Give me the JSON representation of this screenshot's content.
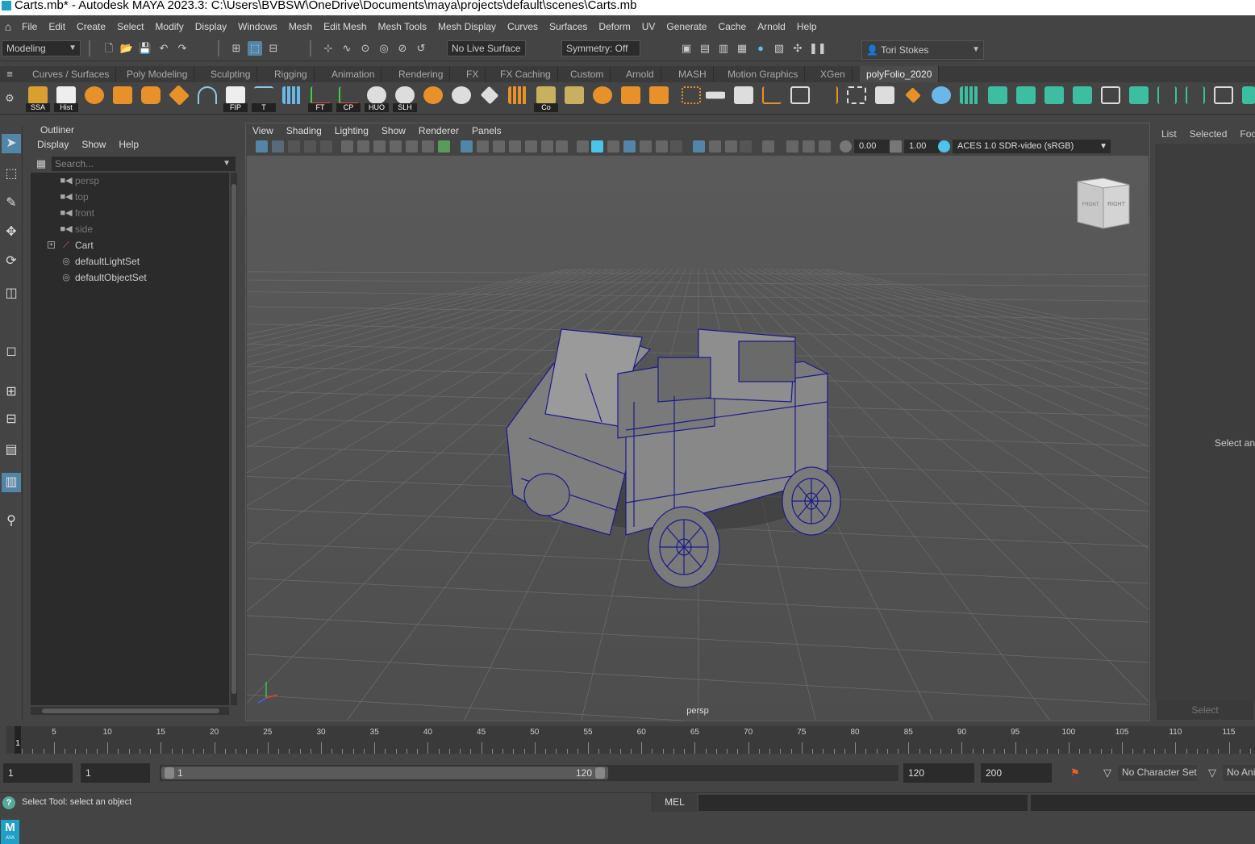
{
  "window": {
    "title": "Carts.mb* - Autodesk MAYA 2023.3: C:\\Users\\BVBSW\\OneDrive\\Documents\\maya\\projects\\default\\scenes\\Carts.mb"
  },
  "menu": [
    "File",
    "Edit",
    "Create",
    "Select",
    "Modify",
    "Display",
    "Windows",
    "Mesh",
    "Edit Mesh",
    "Mesh Tools",
    "Mesh Display",
    "Curves",
    "Surfaces",
    "Deform",
    "UV",
    "Generate",
    "Cache",
    "Arnold",
    "Help"
  ],
  "status": {
    "workspace": "Modeling",
    "live_surface": "No Live Surface",
    "symmetry": "Symmetry: Off",
    "user": "Tori Stokes"
  },
  "shelf": {
    "tabs": [
      "Curves / Surfaces",
      "Poly Modeling",
      "Sculpting",
      "Rigging",
      "Animation",
      "Rendering",
      "FX",
      "FX Caching",
      "Custom",
      "Arnold",
      "MASH",
      "Motion Graphics",
      "XGen",
      "polyFolio_2020"
    ],
    "active_tab": "polyFolio_2020",
    "labels": [
      "SSA",
      "Hist",
      "FIP",
      "T",
      "FT",
      "CP",
      "HUO",
      "SLH",
      "Co"
    ]
  },
  "outliner": {
    "title": "Outliner",
    "menu": [
      "Display",
      "Show",
      "Help"
    ],
    "search_placeholder": "Search...",
    "items": [
      {
        "name": "persp",
        "type": "camera",
        "dim": true
      },
      {
        "name": "top",
        "type": "camera",
        "dim": true
      },
      {
        "name": "front",
        "type": "camera",
        "dim": true
      },
      {
        "name": "side",
        "type": "camera",
        "dim": true
      },
      {
        "name": "Cart",
        "type": "group",
        "dim": false
      },
      {
        "name": "defaultLightSet",
        "type": "set",
        "dim": false
      },
      {
        "name": "defaultObjectSet",
        "type": "set",
        "dim": false
      }
    ]
  },
  "viewport": {
    "menu": [
      "View",
      "Shading",
      "Lighting",
      "Show",
      "Renderer",
      "Panels"
    ],
    "exposure": "0.00",
    "gamma": "1.00",
    "color_space": "ACES 1.0 SDR-video (sRGB)",
    "camera_label": "persp",
    "viewcube_front": "FRONT",
    "viewcube_right": "RIGHT",
    "axis_colors": {
      "x": "#e04040",
      "y": "#40c040",
      "z": "#4060ff"
    },
    "wire_color": "#1a1a8c"
  },
  "attribute_panel": {
    "tabs": [
      "List",
      "Selected",
      "Focu"
    ],
    "message": "Select an",
    "button": "Select"
  },
  "timeline": {
    "ticks": [
      5,
      10,
      15,
      20,
      25,
      30,
      35,
      40,
      45,
      50,
      55,
      60,
      65,
      70,
      75,
      80,
      85,
      90,
      95,
      100,
      105,
      110,
      115
    ],
    "current_frame": "1"
  },
  "range": {
    "start": "1",
    "playback_start": "1",
    "slider_start": "1",
    "slider_end": "120",
    "playback_end": "120",
    "end": "200",
    "character_set": "No Character Set",
    "anim_layer": "No Ani"
  },
  "help_line": {
    "message": "Select Tool: select an object",
    "mel_label": "MEL"
  }
}
